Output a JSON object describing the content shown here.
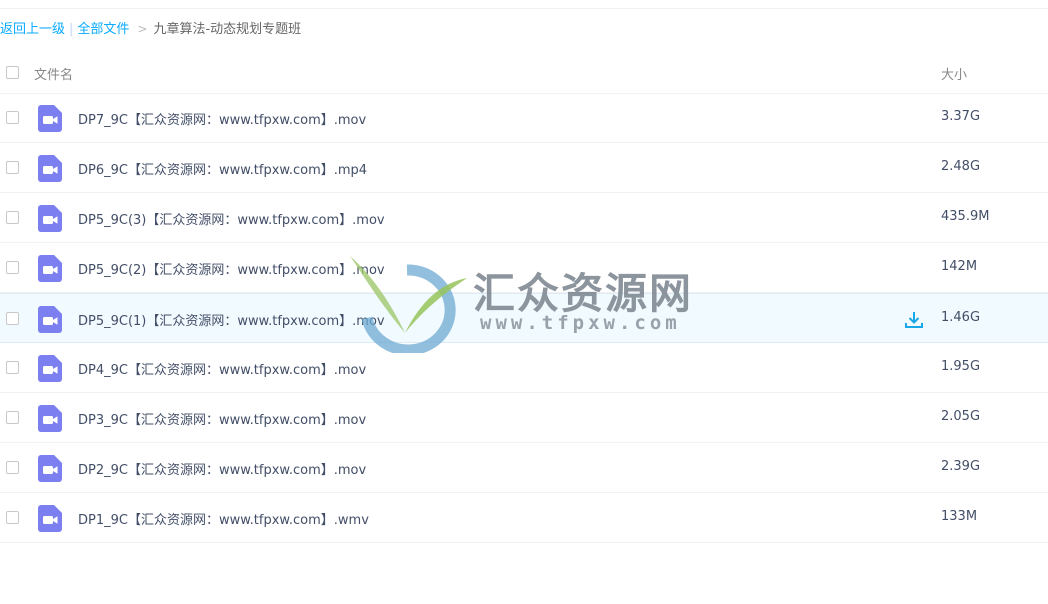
{
  "breadcrumb": {
    "back_label": "返回上一级",
    "separator": "|",
    "all_files_label": "全部文件",
    "arrow": ">",
    "current_folder": "九章算法-动态规划专题班"
  },
  "table_header": {
    "name_label": "文件名",
    "size_label": "大小"
  },
  "files": [
    {
      "name": "DP7_9C【汇众资源网：www.tfpxw.com】.mov",
      "size": "3.37G",
      "icon": "video-file-icon"
    },
    {
      "name": "DP6_9C【汇众资源网：www.tfpxw.com】.mp4",
      "size": "2.48G",
      "icon": "video-file-icon"
    },
    {
      "name": "DP5_9C(3)【汇众资源网：www.tfpxw.com】.mov",
      "size": "435.9M",
      "icon": "video-file-icon"
    },
    {
      "name": "DP5_9C(2)【汇众资源网：www.tfpxw.com】.mov",
      "size": "142M",
      "icon": "video-file-icon"
    },
    {
      "name": "DP5_9C(1)【汇众资源网：www.tfpxw.com】.mov",
      "size": "1.46G",
      "icon": "video-file-icon",
      "hovered": true
    },
    {
      "name": "DP4_9C【汇众资源网：www.tfpxw.com】.mov",
      "size": "1.95G",
      "icon": "video-file-icon"
    },
    {
      "name": "DP3_9C【汇众资源网：www.tfpxw.com】.mov",
      "size": "2.05G",
      "icon": "video-file-icon"
    },
    {
      "name": "DP2_9C【汇众资源网：www.tfpxw.com】.mov",
      "size": "2.39G",
      "icon": "video-file-icon"
    },
    {
      "name": "DP1_9C【汇众资源网：www.tfpxw.com】.wmv",
      "size": "133M",
      "icon": "video-file-icon"
    }
  ],
  "watermark": {
    "title": "汇众资源网",
    "url": "www.tfpxw.com"
  },
  "colors": {
    "link": "#09aaff",
    "video_icon": "#7b7ff0",
    "download_icon": "#1aa7e6",
    "hover_row": "#f1faff"
  }
}
